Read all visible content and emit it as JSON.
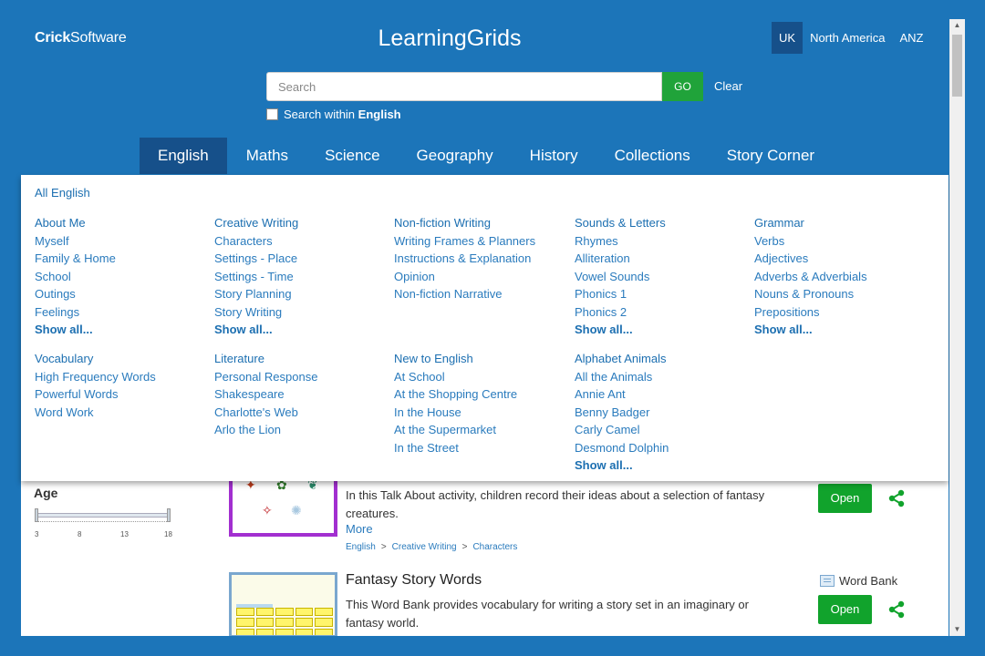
{
  "header": {
    "logo_bold": "Crick",
    "logo_rest": "Software",
    "site_title": "LearningGrids",
    "regions": [
      "UK",
      "North America",
      "ANZ"
    ],
    "active_region": "UK"
  },
  "search": {
    "placeholder": "Search",
    "go_label": "GO",
    "clear_label": "Clear",
    "within_prefix": "Search within",
    "within_subject": "English"
  },
  "nav": {
    "tabs": [
      "English",
      "Maths",
      "Science",
      "Geography",
      "History",
      "Collections",
      "Story Corner"
    ],
    "active": "English"
  },
  "menu": {
    "all_label": "All English",
    "show_all": "Show all...",
    "columns_row1": [
      {
        "head": "About Me",
        "items": [
          "Myself",
          "Family & Home",
          "School",
          "Outings",
          "Feelings"
        ],
        "show_all": true
      },
      {
        "head": "Creative Writing",
        "items": [
          "Characters",
          "Settings - Place",
          "Settings - Time",
          "Story Planning",
          "Story Writing"
        ],
        "show_all": true
      },
      {
        "head": "Non-fiction Writing",
        "items": [
          "Writing Frames & Planners",
          "Instructions & Explanation",
          "Opinion",
          "Non-fiction Narrative"
        ],
        "show_all": false
      },
      {
        "head": "Sounds & Letters",
        "items": [
          "Rhymes",
          "Alliteration",
          "Vowel Sounds",
          "Phonics 1",
          "Phonics 2"
        ],
        "show_all": true
      },
      {
        "head": "Grammar",
        "items": [
          "Verbs",
          "Adjectives",
          "Adverbs & Adverbials",
          "Nouns & Pronouns",
          "Prepositions"
        ],
        "show_all": true
      }
    ],
    "columns_row2": [
      {
        "head": "Vocabulary",
        "items": [
          "High Frequency Words",
          "Powerful Words",
          "Word Work"
        ],
        "show_all": false
      },
      {
        "head": "Literature",
        "items": [
          "Personal Response",
          "Shakespeare",
          "Charlotte's Web",
          "Arlo the Lion"
        ],
        "show_all": false
      },
      {
        "head": "New to English",
        "items": [
          "At School",
          "At the Shopping Centre",
          "In the House",
          "At the Supermarket",
          "In the Street"
        ],
        "show_all": false
      },
      {
        "head": "Alphabet Animals",
        "items": [
          "All the Animals",
          "Annie Ant",
          "Benny Badger",
          "Carly Camel",
          "Desmond Dolphin"
        ],
        "show_all": true
      }
    ]
  },
  "filters": {
    "age_label": "Age",
    "age_ticks": [
      "3",
      "8",
      "13",
      "18"
    ],
    "age_min": 3,
    "age_max": 18
  },
  "results": [
    {
      "description": "In this Talk About activity, children record their ideas about a selection of fantasy creatures.",
      "more_label": "More",
      "breadcrumb": [
        "English",
        "Creative Writing",
        "Characters"
      ],
      "open_label": "Open",
      "border_color": "#a22fd0"
    },
    {
      "title": "Fantasy Story Words",
      "type_label": "Word Bank",
      "description": "This Word Bank provides vocabulary for writing a story set in an imaginary or fantasy world.",
      "open_label": "Open"
    }
  ],
  "colors": {
    "brand_blue": "#1c75b9",
    "active_tab": "#16508a",
    "go_green": "#20a33a",
    "link_blue": "#1c6fb1",
    "share_green": "#11a32c"
  }
}
